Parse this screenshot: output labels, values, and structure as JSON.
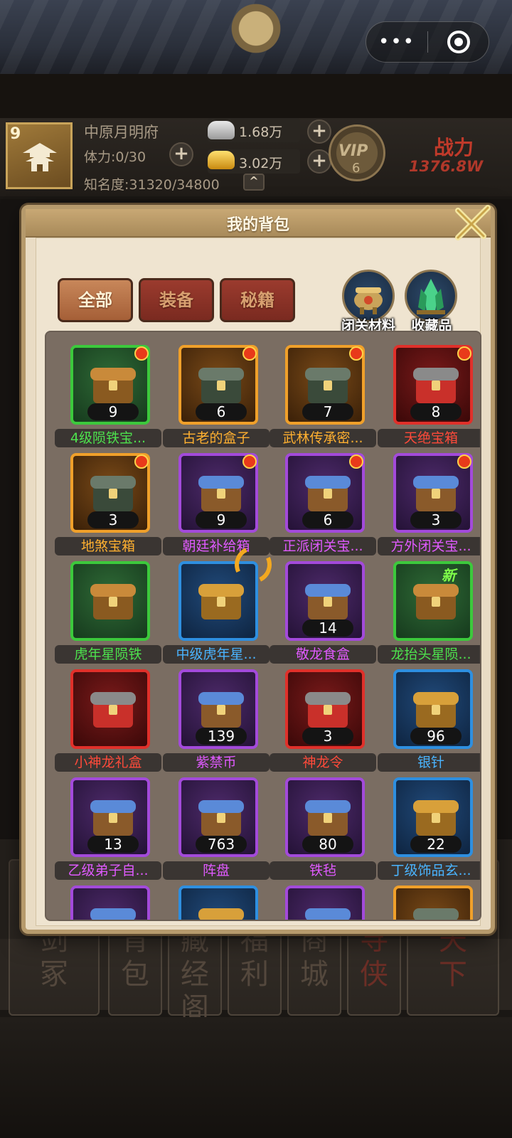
{
  "window_controls": {
    "more_label": "•••"
  },
  "player": {
    "level": "9",
    "name": "中原月明府",
    "stamina": "体力:0/30",
    "fame": "知名度:31320/34800",
    "silver": "1.68万",
    "gold": "3.02万",
    "vip_label": "VIP",
    "vip_level": "6",
    "power_label": "战力",
    "power_value": "1376.8W"
  },
  "modal": {
    "title": "我的背包",
    "tabs": [
      {
        "label": "全部",
        "active": true
      },
      {
        "label": "装备",
        "active": false
      },
      {
        "label": "秘籍",
        "active": false
      }
    ],
    "side_buttons": [
      {
        "label": "闭关材料",
        "icon": "cauldron-icon"
      },
      {
        "label": "收藏品",
        "icon": "crystal-icon"
      }
    ],
    "items": [
      {
        "name": "4级陨铁宝...",
        "count": "9",
        "rarity": "green",
        "dot": true,
        "icon": "treasure-chest-open-icon"
      },
      {
        "name": "古老的盒子",
        "count": "6",
        "rarity": "orange",
        "dot": true,
        "icon": "ancient-box-icon"
      },
      {
        "name": "武林传承密...",
        "count": "7",
        "rarity": "orange",
        "dot": true,
        "icon": "golden-chest-icon"
      },
      {
        "name": "天绝宝箱",
        "count": "8",
        "rarity": "red",
        "dot": true,
        "icon": "octagon-chest-icon"
      },
      {
        "name": "地煞宝箱",
        "count": "3",
        "rarity": "orange",
        "dot": true,
        "icon": "red-gold-chest-icon"
      },
      {
        "name": "朝廷补给箱",
        "count": "9",
        "rarity": "purple",
        "dot": true,
        "icon": "blue-supply-chest-icon"
      },
      {
        "name": "正派闭关宝...",
        "count": "6",
        "rarity": "purple",
        "dot": true,
        "icon": "blue-wood-chest-icon"
      },
      {
        "name": "方外闭关宝...",
        "count": "3",
        "rarity": "purple",
        "dot": true,
        "icon": "gold-wood-chest-icon"
      },
      {
        "name": "虎年星陨铁",
        "count": "",
        "rarity": "green",
        "dot": false,
        "icon": "silver-tiger-icon"
      },
      {
        "name": "中级虎年星...",
        "count": "",
        "rarity": "blue",
        "dot": false,
        "icon": "gold-tiger-icon"
      },
      {
        "name": "敬龙食盒",
        "count": "14",
        "rarity": "purple",
        "dot": false,
        "icon": "food-box-icon"
      },
      {
        "name": "龙抬头星陨...",
        "count": "",
        "rarity": "green",
        "dot": false,
        "icon": "blue-dragon-icon",
        "tag": "新"
      },
      {
        "name": "小神龙礼盒",
        "count": "",
        "rarity": "red",
        "dot": false,
        "icon": "dragon-gift-box-icon"
      },
      {
        "name": "紫禁币",
        "count": "139",
        "rarity": "purple",
        "dot": false,
        "icon": "gold-coin-icon"
      },
      {
        "name": "神龙令",
        "count": "3",
        "rarity": "red",
        "dot": false,
        "icon": "dragon-token-icon"
      },
      {
        "name": "银针",
        "count": "96",
        "rarity": "blue",
        "dot": false,
        "icon": "silver-needle-icon"
      },
      {
        "name": "乙级弟子自...",
        "count": "13",
        "rarity": "purple",
        "dot": false,
        "icon": "mystery-disciple-icon"
      },
      {
        "name": "阵盘",
        "count": "763",
        "rarity": "purple",
        "dot": false,
        "icon": "bagua-plate-icon"
      },
      {
        "name": "铁毡",
        "count": "80",
        "rarity": "purple",
        "dot": false,
        "icon": "iron-anvil-icon"
      },
      {
        "name": "丁级饰品玄...",
        "count": "22",
        "rarity": "blue",
        "dot": false,
        "icon": "ore-icon"
      },
      {
        "name": "",
        "count": "",
        "rarity": "purple",
        "dot": false,
        "icon": "crystal-shard-icon"
      },
      {
        "name": "",
        "count": "",
        "rarity": "blue",
        "dot": false,
        "icon": "silver-ore-icon"
      },
      {
        "name": "",
        "count": "",
        "rarity": "purple",
        "dot": false,
        "icon": "blue-crystal-icon"
      },
      {
        "name": "",
        "count": "",
        "rarity": "orange",
        "dot": false,
        "icon": "red-gem-icon"
      }
    ]
  },
  "bottom_nav": [
    {
      "label": "剑\n冢",
      "color": "#54483d"
    },
    {
      "label": "背\n包",
      "color": "#54483d"
    },
    {
      "label": "藏\n经\n阁",
      "color": "#54483d"
    },
    {
      "label": "福\n利",
      "color": "#54483d"
    },
    {
      "label": "商\n城",
      "color": "#54483d"
    },
    {
      "label": "寻\n侠",
      "color": "#6c2e26"
    },
    {
      "label": "天\n下",
      "color": "#6c2e26"
    }
  ]
}
